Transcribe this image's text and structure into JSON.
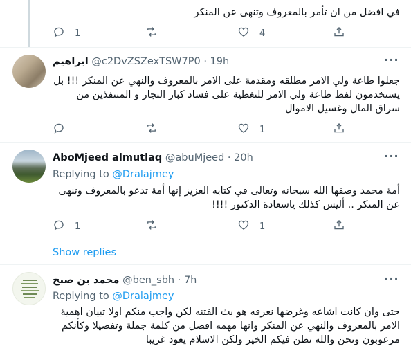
{
  "tweets": [
    {
      "body": "في افضل من ان تأمر بالمعروف وتنهى عن المنكر",
      "actions": {
        "reply": "1",
        "retweet": "",
        "like": "4"
      }
    },
    {
      "name": "ابراهيم",
      "handle": "@c2DvZSZexTSW7P0",
      "dot": "·",
      "time": "19h",
      "body": "جعلوا طاعة ولي الامر مطلقه ومقدمة على الامر بالمعروف والنهي عن المنكر !!! بل يستخدمون لفظ طاعة ولي الامر للتغطية على فساد كبار التجار و المتنفذين من سراق المال وغسيل الاموال",
      "actions": {
        "reply": "",
        "retweet": "",
        "like": "1"
      }
    },
    {
      "name": "AboMjeed almutlaq",
      "handle": "@abuMjeed",
      "dot": "·",
      "time": "20h",
      "replying_prefix": "Replying to",
      "replying_to": "@Dralajmey",
      "body": "أمة محمد وصفها الله سبحانه وتعالى في كتابه العزيز إنها أمة تدعو بالمعروف وتنهى عن المنكر .. أليس كذلك ياسعادة الدكتور !!!!",
      "actions": {
        "reply": "1",
        "retweet": "",
        "like": "1"
      }
    },
    {
      "name": "محمد بن صبح",
      "handle": "@ben_sbh",
      "dot": "·",
      "time": "7h",
      "replying_prefix": "Replying to",
      "replying_to": "@Dralajmey",
      "body": "حتى وان كانت اشاعه وغرضها نعرفه هو بث الفتنه لكن واجب منكم اولا تبيان اهمية الامر بالمعروف والنهي عن المنكر وانها مهمه افضل من كلمة جملة وتفصيلا وكأنكم مرعوبون ونحن والله نظن فيكم الخير ولكن الاسلام يعود غريبا"
    }
  ],
  "show_replies": "Show replies",
  "icons": {
    "reply": "reply-icon",
    "retweet": "retweet-icon",
    "like": "like-icon",
    "share": "share-icon",
    "more": "more-icon"
  },
  "colors": {
    "accent": "#1d9bf0",
    "secondary_text": "#536471",
    "divider": "#eff3f4",
    "thread_line": "#cfd9de"
  }
}
